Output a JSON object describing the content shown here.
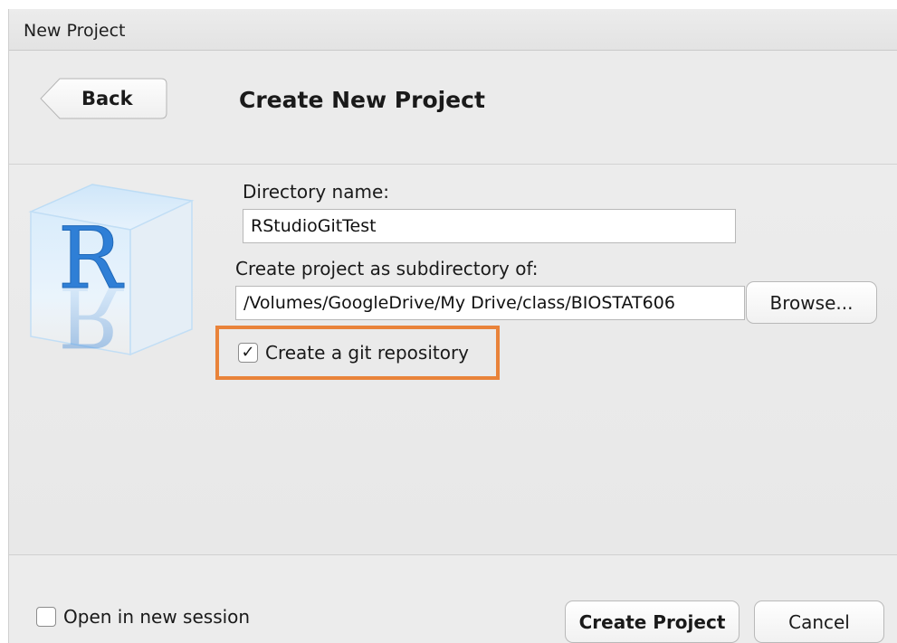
{
  "window": {
    "title": "New Project"
  },
  "header": {
    "back_label": "Back",
    "title": "Create New Project"
  },
  "form": {
    "directory_label": "Directory name:",
    "directory_value": "RStudioGitTest",
    "subdir_label": "Create project as subdirectory of:",
    "subdir_value": "/Volumes/GoogleDrive/My Drive/class/BIOSTAT606",
    "browse_label": "Browse...",
    "git_label": "Create a git repository",
    "git_checked": true
  },
  "footer": {
    "new_session_label": "Open in new session",
    "new_session_checked": false,
    "create_label": "Create Project",
    "cancel_label": "Cancel"
  },
  "colors": {
    "highlight": "#e9833a",
    "r_logo": "#2f7fd6"
  },
  "icons": {
    "logo": "r-logo-icon",
    "check": "checkmark-icon"
  }
}
